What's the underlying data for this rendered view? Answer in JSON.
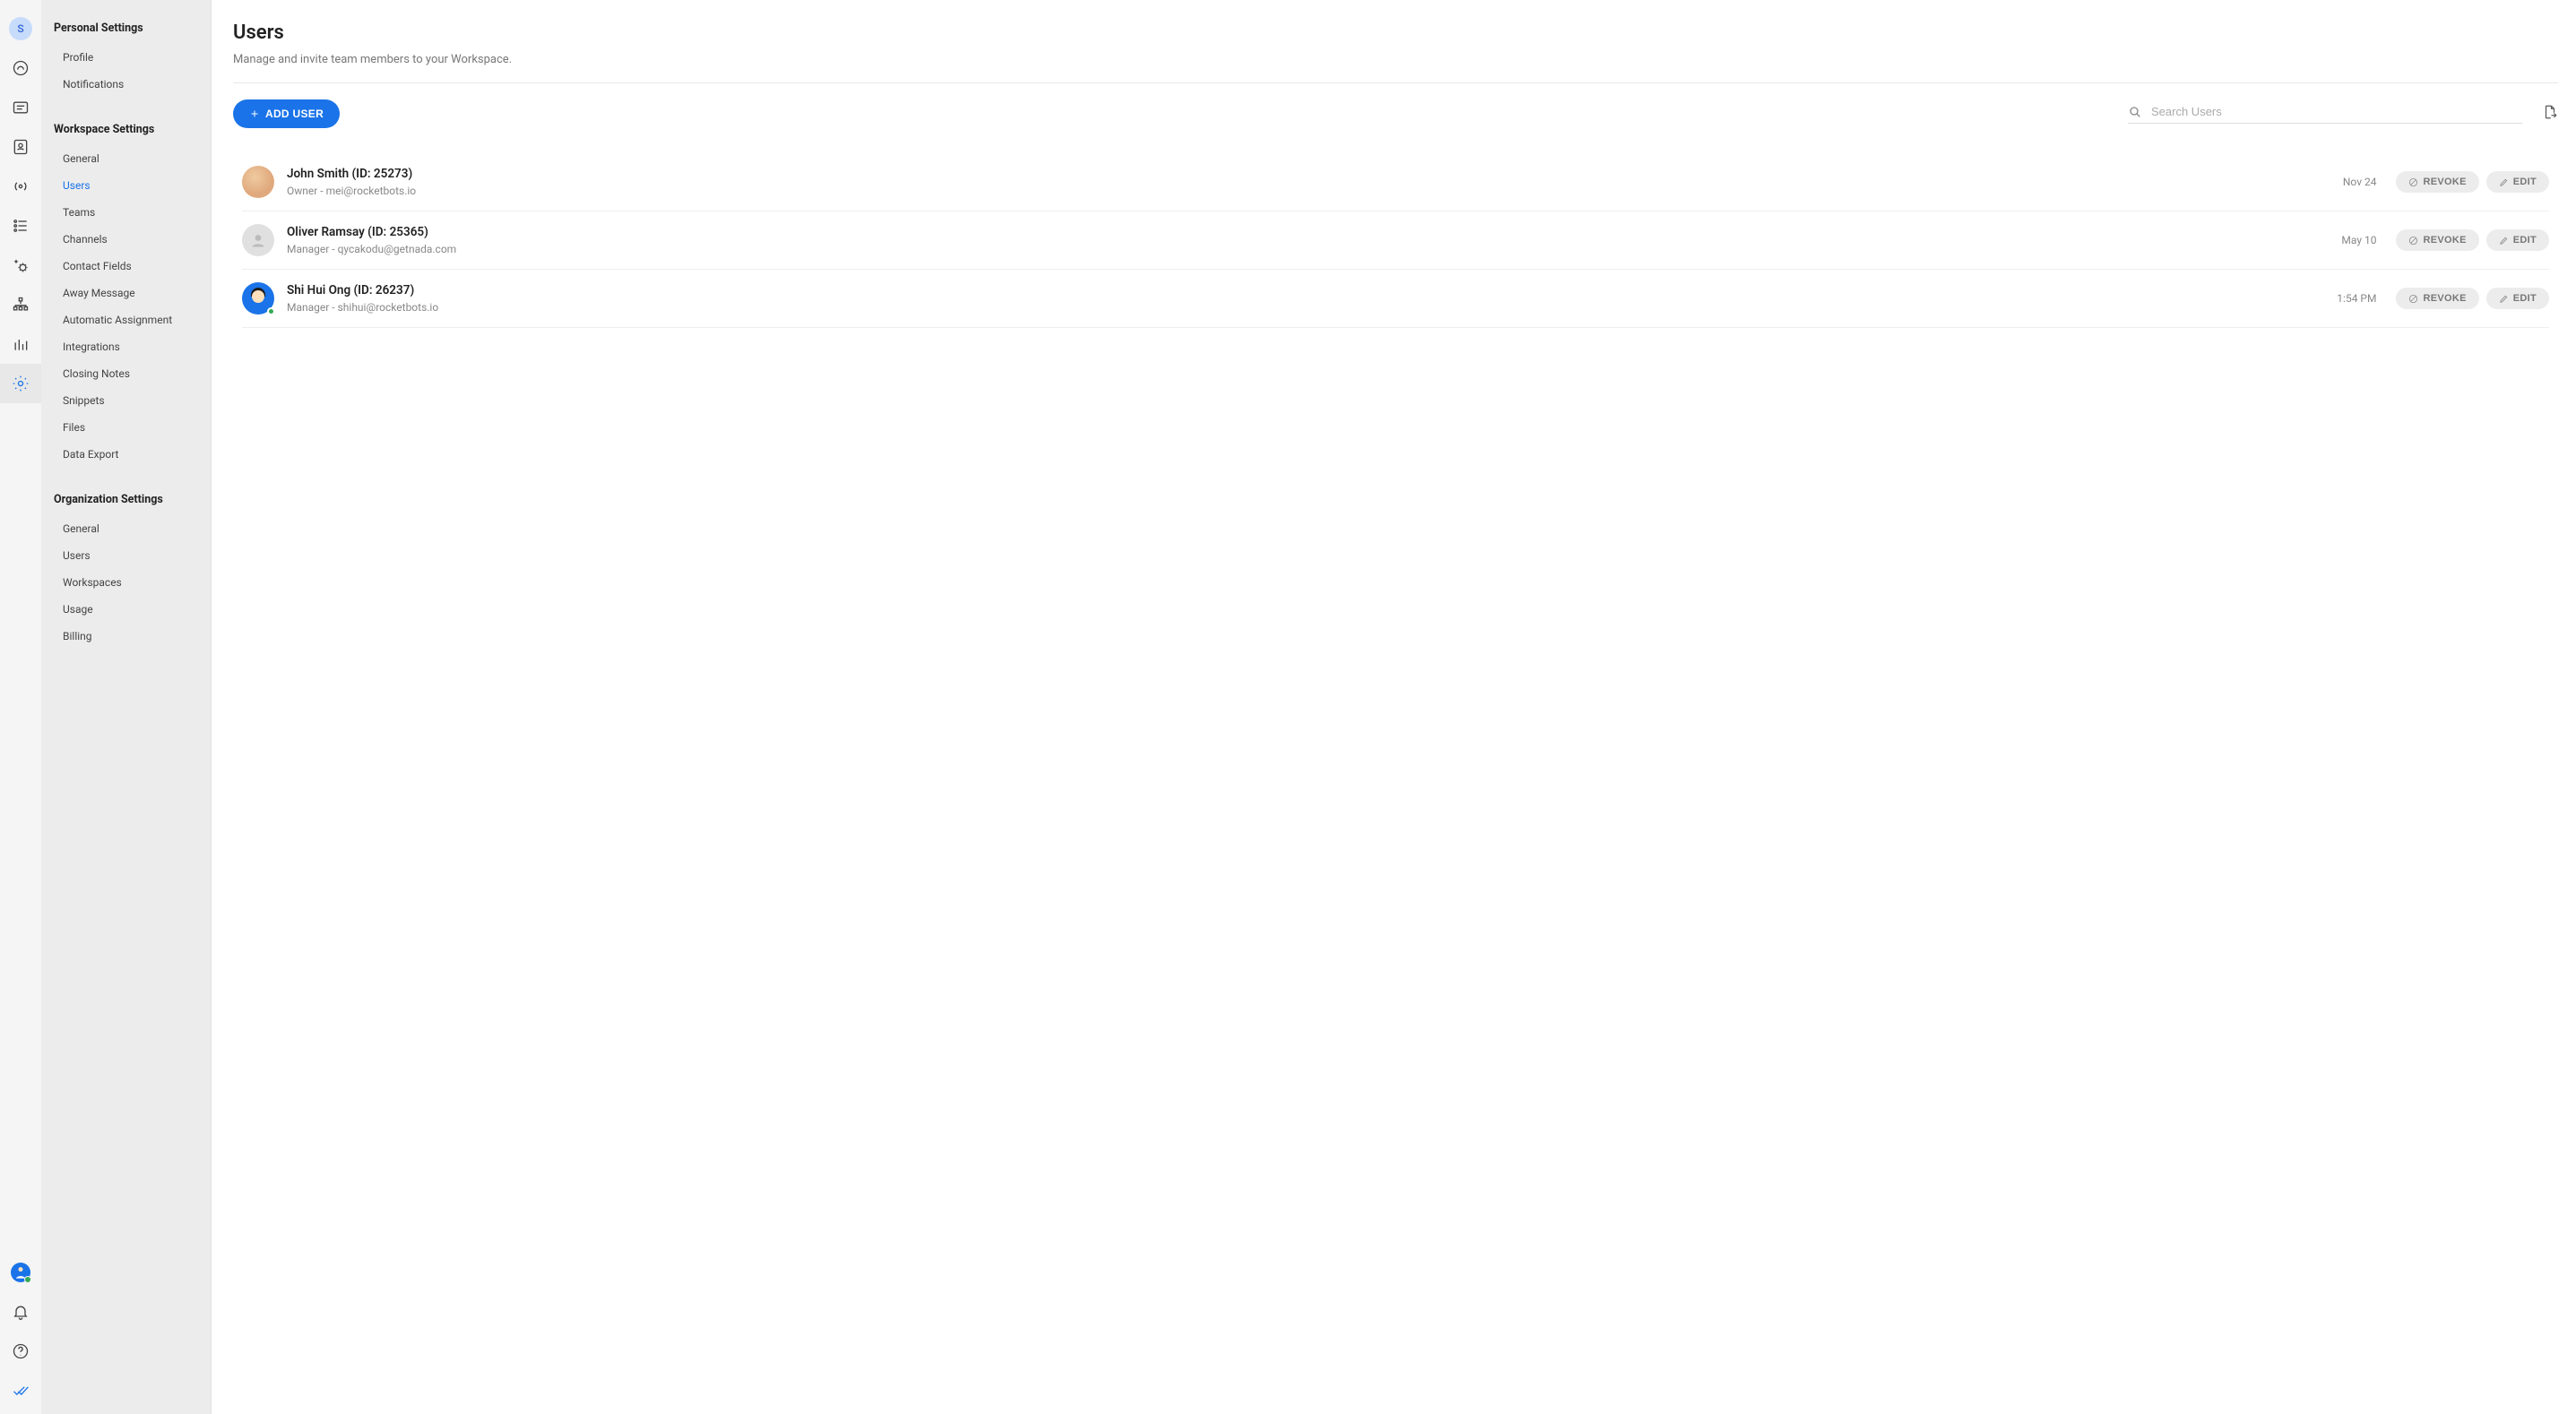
{
  "rail": {
    "workspace_initial": "S"
  },
  "sidebar": {
    "personal_title": "Personal Settings",
    "personal_items": {
      "profile": "Profile",
      "notifications": "Notifications"
    },
    "workspace_title": "Workspace Settings",
    "workspace_items": {
      "general": "General",
      "users": "Users",
      "teams": "Teams",
      "channels": "Channels",
      "contact_fields": "Contact Fields",
      "away_message": "Away Message",
      "automatic_assignment": "Automatic Assignment",
      "integrations": "Integrations",
      "closing_notes": "Closing Notes",
      "snippets": "Snippets",
      "files": "Files",
      "data_export": "Data Export"
    },
    "organization_title": "Organization Settings",
    "organization_items": {
      "general": "General",
      "users": "Users",
      "workspaces": "Workspaces",
      "usage": "Usage",
      "billing": "Billing"
    }
  },
  "page": {
    "title": "Users",
    "subtitle": "Manage and invite team members to your Workspace.",
    "add_user_label": "ADD USER",
    "search_placeholder": "Search Users",
    "revoke_label": "REVOKE",
    "edit_label": "EDIT"
  },
  "users": [
    {
      "name": "John Smith (ID: 25273)",
      "meta": "Owner - mei@rocketbots.io",
      "date": "Nov 24"
    },
    {
      "name": "Oliver Ramsay (ID: 25365)",
      "meta": "Manager - qycakodu@getnada.com",
      "date": "May 10"
    },
    {
      "name": "Shi Hui Ong (ID: 26237)",
      "meta": "Manager - shihui@rocketbots.io",
      "date": "1:54 PM"
    }
  ]
}
